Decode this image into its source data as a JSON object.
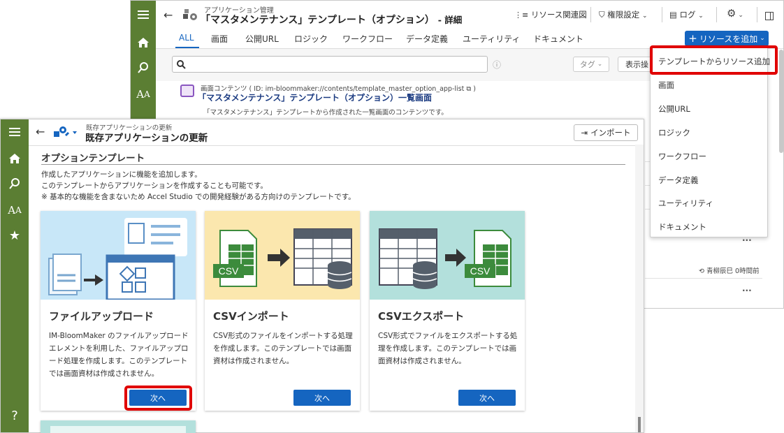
{
  "back_window": {
    "breadcrumb": "アプリケーション管理",
    "title": "「マスタメンテナンス」テンプレート（オプション）",
    "title_suffix": "- 詳細",
    "toolbar": {
      "resource_map": "リソース関連図",
      "permissions": "権限設定",
      "log": "ログ"
    },
    "tabs": [
      "ALL",
      "画面",
      "公開URL",
      "ロジック",
      "ワークフロー",
      "データ定義",
      "ユーティリティ",
      "ドキュメント"
    ],
    "add_resource_label": "リソースを追加",
    "search": {
      "placeholder": "",
      "value": ""
    },
    "tag_label": "タグ",
    "display_label": "表示操",
    "item": {
      "meta": "画面コンテンツ ( ID: im-bloommaker://contents/template_master_option_app-list",
      "meta_close": ")",
      "title": "「マスタメンテナンス」テンプレート（オプション）一覧画面",
      "desc": "「マスタメンテナンス」テンプレートから作成された一覧画面のコンテンツです。"
    },
    "updated": "青柳辰巳 0時間前"
  },
  "dropdown": {
    "items": [
      "テンプレートからリソース追加",
      "画面",
      "公開URL",
      "ロジック",
      "ワークフロー",
      "データ定義",
      "ユーティリティ",
      "ドキュメント"
    ]
  },
  "front_window": {
    "breadcrumb": "既存アプリケーションの更新",
    "title": "既存アプリケーションの更新",
    "import_label": "インポート",
    "section_title": "オプションテンプレート",
    "intro": [
      "作成したアプリケーションに機能を追加します。",
      "このテンプレートからアプリケーションを作成することも可能です。",
      "※ 基本的な機能を含まないため Accel Studio での開発経験がある方向けのテンプレートです。"
    ],
    "cards": [
      {
        "title": "ファイルアップロード",
        "desc": "IM-BloomMaker のファイルアップロードエレメントを利用した、ファイルアップロード処理を作成します。このテンプレートでは画面資材は作成されません。",
        "button": "次へ"
      },
      {
        "title": "CSVインポート",
        "desc": "CSV形式のファイルをインポートする処理を作成します。このテンプレートでは画面資材は作成されません。",
        "button": "次へ",
        "badge": "CSV"
      },
      {
        "title": "CSVエクスポート",
        "desc": "CSV形式でファイルをエクスポートする処理を作成します。このテンプレートでは画面資材は作成されません。",
        "button": "次へ",
        "badge": "CSV"
      }
    ]
  },
  "help_label": "?",
  "colors": {
    "sidebar": "#5b7e33",
    "primary": "#1565c0",
    "highlight": "#e00000",
    "card1_bg": "#c8e7f8",
    "card2_bg": "#fbe7ae",
    "card3_bg": "#b3e0dc"
  }
}
